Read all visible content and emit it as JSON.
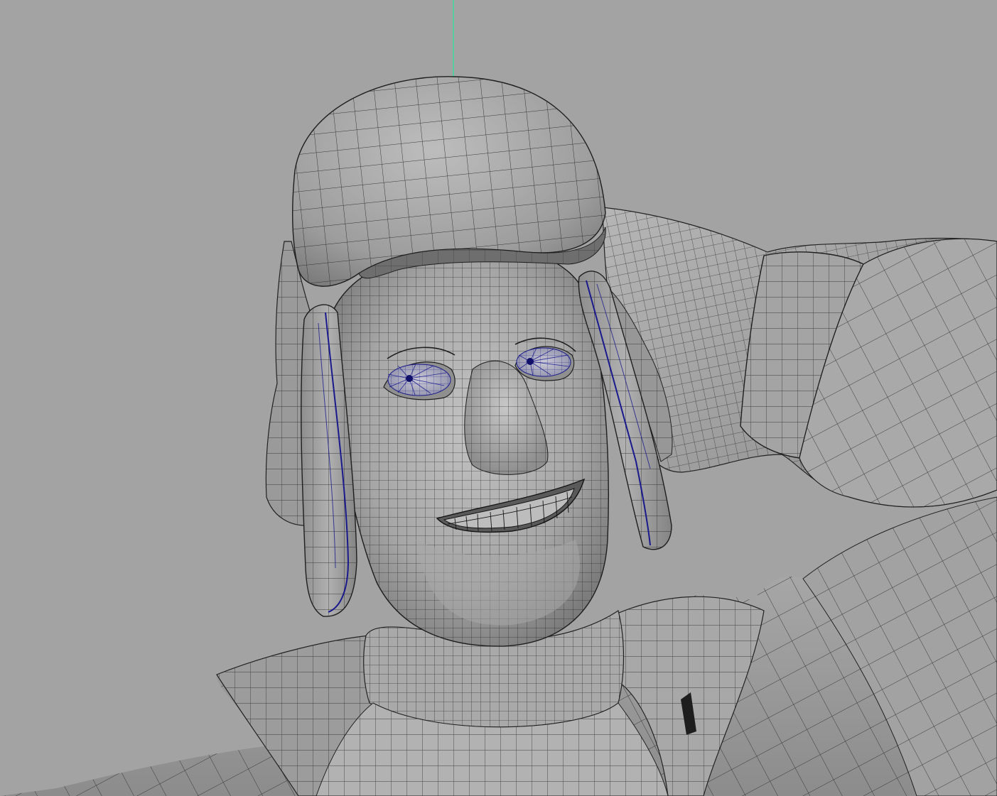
{
  "viewport": {
    "background_color": "#a3a3a3",
    "wire_color": "#2a2a2a",
    "selected_wire_color": "#1a1a8c",
    "axis_color": "#3fd99a",
    "surface_light": "#b4b4b4",
    "surface_mid": "#9a9a9a",
    "surface_dark": "#6e6e6e",
    "icons": [
      "manipulator-axis"
    ]
  }
}
